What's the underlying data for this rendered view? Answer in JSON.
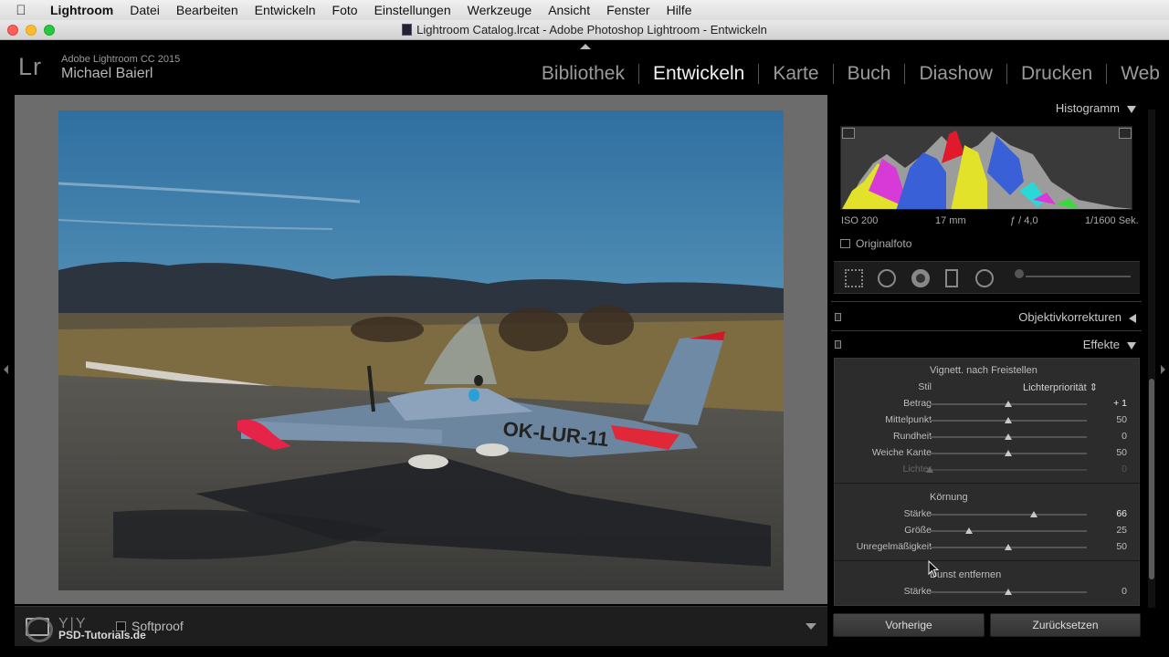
{
  "menubar": {
    "apple": "",
    "items": [
      "Lightroom",
      "Datei",
      "Bearbeiten",
      "Entwickeln",
      "Foto",
      "Einstellungen",
      "Werkzeuge",
      "Ansicht",
      "Fenster",
      "Hilfe"
    ]
  },
  "window": {
    "title": "Lightroom Catalog.lrcat - Adobe Photoshop Lightroom - Entwickeln"
  },
  "identity": {
    "logo": "Lr",
    "product": "Adobe Lightroom CC 2015",
    "user": "Michael Baierl"
  },
  "modules": [
    {
      "label": "Bibliothek",
      "active": false
    },
    {
      "label": "Entwickeln",
      "active": true
    },
    {
      "label": "Karte",
      "active": false
    },
    {
      "label": "Buch",
      "active": false
    },
    {
      "label": "Diashow",
      "active": false
    },
    {
      "label": "Drucken",
      "active": false
    },
    {
      "label": "Web",
      "active": false
    }
  ],
  "photo": {
    "registration": "OK-LUR-11"
  },
  "toolbar": {
    "yy": "Y|Y",
    "softproof": "Softproof"
  },
  "watermark": "PSD-Tutorials.de",
  "histogram": {
    "title": "Histogramm",
    "iso": "ISO 200",
    "focal": "17 mm",
    "aperture": "ƒ / 4,0",
    "shutter": "1/1600 Sek.",
    "original": "Originalfoto"
  },
  "panels": {
    "objektiv": "Objektivkorrekturen",
    "effekte": "Effekte"
  },
  "vignette": {
    "title": "Vignett. nach Freistellen",
    "stil_label": "Stil",
    "stil_value": "Lichterpriorität ⇕",
    "sliders": [
      {
        "label": "Betrag",
        "value": "+ 1",
        "pos": 0.5,
        "dim": false
      },
      {
        "label": "Mittelpunkt",
        "value": "50",
        "pos": 0.5,
        "dim": false
      },
      {
        "label": "Rundheit",
        "value": "0",
        "pos": 0.5,
        "dim": false
      },
      {
        "label": "Weiche Kante",
        "value": "50",
        "pos": 0.5,
        "dim": false
      },
      {
        "label": "Lichter",
        "value": "0",
        "pos": 0.0,
        "dim": true
      }
    ]
  },
  "koernung": {
    "title": "Körnung",
    "sliders": [
      {
        "label": "Stärke",
        "value": "66",
        "pos": 0.66,
        "dim": false
      },
      {
        "label": "Größe",
        "value": "25",
        "pos": 0.25,
        "dim": false
      },
      {
        "label": "Unregelmäßigkeit",
        "value": "50",
        "pos": 0.5,
        "dim": false
      }
    ]
  },
  "dunst": {
    "title": "Dunst entfernen",
    "sliders": [
      {
        "label": "Stärke",
        "value": "0",
        "pos": 0.5,
        "dim": false
      }
    ]
  },
  "buttons": {
    "prev": "Vorherige",
    "reset": "Zurücksetzen"
  },
  "colors": {
    "accent_active": "#f0f0f0",
    "panel_bg": "#2c2c2c",
    "workspace_bg": "#6c6c6c"
  }
}
